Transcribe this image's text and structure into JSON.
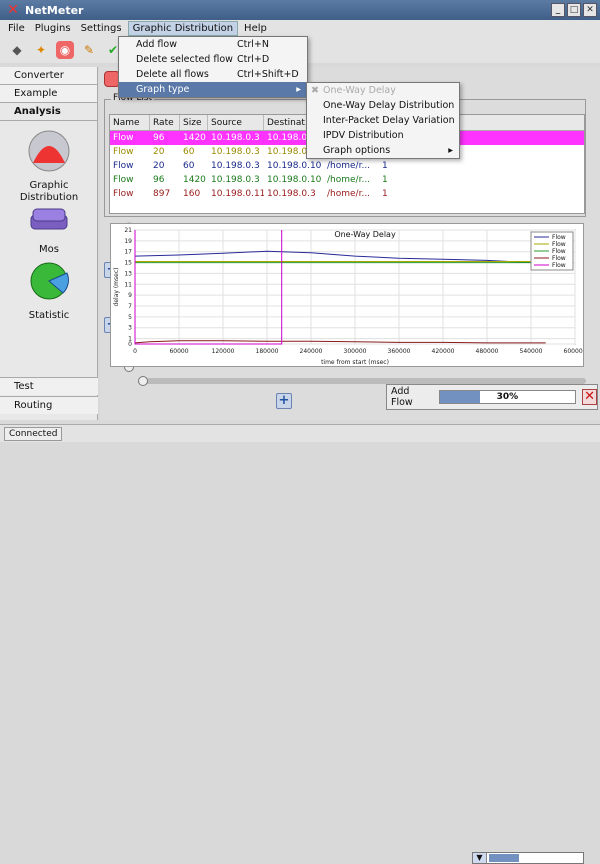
{
  "window": {
    "title": "NetMeter"
  },
  "menubar": [
    "File",
    "Plugins",
    "Settings",
    "Graphic Distribution",
    "Help"
  ],
  "dropdown": {
    "items": [
      {
        "label": "Add flow",
        "shortcut": "Ctrl+N"
      },
      {
        "label": "Delete selected flow",
        "shortcut": "Ctrl+D"
      },
      {
        "label": "Delete all flows",
        "shortcut": "Ctrl+Shift+D"
      },
      {
        "label": "Graph type",
        "shortcut": "",
        "submenu": true
      }
    ]
  },
  "submenu": {
    "items": [
      {
        "label": "One-Way Delay",
        "disabled": true
      },
      {
        "label": "One-Way Delay Distribution",
        "disabled": false
      },
      {
        "label": "Inter-Packet Delay Variation",
        "disabled": false
      },
      {
        "label": "IPDV Distribution",
        "disabled": false
      },
      {
        "label": "Graph options",
        "disabled": false,
        "submenu": true
      }
    ]
  },
  "sidebar": {
    "tabs": [
      "Converter",
      "Example",
      "Analysis"
    ],
    "items": [
      {
        "label": "Graphic Distribution",
        "icon": "graphic-distribution-icon"
      },
      {
        "label": "Mos",
        "icon": "mos-icon"
      },
      {
        "label": "Statistic",
        "icon": "statistic-icon"
      }
    ],
    "bottom_tabs": [
      "Test",
      "Routing"
    ]
  },
  "flow_list": {
    "legend": "Flow List",
    "columns": [
      "Name",
      "Rate",
      "Size",
      "Source",
      "Destinat..."
    ],
    "rows": [
      {
        "name": "Flow",
        "rate": "96",
        "size": "1420",
        "source": "10.198.0.3",
        "dest": "10.198.0",
        "path": "",
        "n": "",
        "color": "#ffffff",
        "bg": "#ff33ff"
      },
      {
        "name": "Flow",
        "rate": "20",
        "size": "60",
        "source": "10.198.0.3",
        "dest": "10.198.0",
        "path": "",
        "n": "",
        "color": "#9a8a00",
        "bg": ""
      },
      {
        "name": "Flow",
        "rate": "20",
        "size": "60",
        "source": "10.198.0.3",
        "dest": "10.198.0.10",
        "path": "/home/r...",
        "n": "1",
        "color": "#1a2a8a",
        "bg": ""
      },
      {
        "name": "Flow",
        "rate": "96",
        "size": "1420",
        "source": "10.198.0.3",
        "dest": "10.198.0.10",
        "path": "/home/r...",
        "n": "1",
        "color": "#1a7a1a",
        "bg": ""
      },
      {
        "name": "Flow",
        "rate": "897",
        "size": "160",
        "source": "10.198.0.11",
        "dest": "10.198.0.3",
        "path": "/home/r...",
        "n": "1",
        "color": "#9a1a1a",
        "bg": ""
      }
    ]
  },
  "chart_data": {
    "type": "line",
    "title": "One-Way Delay",
    "xlabel": "time from start (msec)",
    "ylabel": "delay (msec)",
    "xlim": [
      0,
      600000
    ],
    "ylim": [
      0,
      21
    ],
    "x_ticks": [
      0,
      60000,
      120000,
      180000,
      240000,
      300000,
      360000,
      420000,
      480000,
      540000,
      600000
    ],
    "y_ticks": [
      0,
      1,
      3,
      5,
      7,
      9,
      11,
      13,
      15,
      17,
      19,
      21
    ],
    "legend_position": "top-right",
    "grid": true,
    "series": [
      {
        "name": "Flow",
        "color": "#2a2a9a",
        "points": [
          [
            0,
            16.2
          ],
          [
            60000,
            16.4
          ],
          [
            120000,
            16.7
          ],
          [
            180000,
            17.1
          ],
          [
            240000,
            16.8
          ],
          [
            300000,
            16.2
          ],
          [
            360000,
            15.8
          ],
          [
            420000,
            15.6
          ],
          [
            480000,
            15.4
          ],
          [
            540000,
            15.0
          ],
          [
            560000,
            14.8
          ]
        ]
      },
      {
        "name": "Flow",
        "color": "#a8a800",
        "points": [
          [
            0,
            15.2
          ],
          [
            60000,
            15.2
          ],
          [
            120000,
            15.2
          ],
          [
            180000,
            15.2
          ],
          [
            240000,
            15.2
          ],
          [
            300000,
            15.2
          ],
          [
            360000,
            15.2
          ],
          [
            420000,
            15.2
          ],
          [
            480000,
            15.2
          ],
          [
            540000,
            15.2
          ],
          [
            560000,
            15.2
          ]
        ]
      },
      {
        "name": "Flow",
        "color": "#2a9a2a",
        "points": [
          [
            0,
            15.0
          ],
          [
            120000,
            15.0
          ],
          [
            240000,
            15.0
          ],
          [
            360000,
            15.0
          ],
          [
            480000,
            15.0
          ],
          [
            560000,
            15.0
          ]
        ]
      },
      {
        "name": "Flow",
        "color": "#8a1a1a",
        "points": [
          [
            0,
            0.2
          ],
          [
            20000,
            0.4
          ],
          [
            60000,
            0.6
          ],
          [
            120000,
            0.6
          ],
          [
            180000,
            0.5
          ],
          [
            240000,
            0.5
          ],
          [
            300000,
            0.4
          ],
          [
            360000,
            0.3
          ],
          [
            420000,
            0.3
          ],
          [
            480000,
            0.2
          ],
          [
            560000,
            0.2
          ]
        ]
      },
      {
        "name": "Flow",
        "color": "#cc00cc",
        "points": [
          [
            0,
            21
          ],
          [
            0,
            0
          ],
          [
            200000,
            0
          ],
          [
            200000,
            21
          ]
        ]
      }
    ]
  },
  "progress": {
    "label": "Add Flow",
    "value": 30,
    "text": "30%"
  },
  "status": {
    "text": "Connected"
  },
  "icons": {
    "titlebar": "x-logo-icon",
    "toolbar": [
      "tag-icon",
      "magic-icon",
      "record-icon",
      "wrench-icon",
      "check-icon"
    ]
  }
}
